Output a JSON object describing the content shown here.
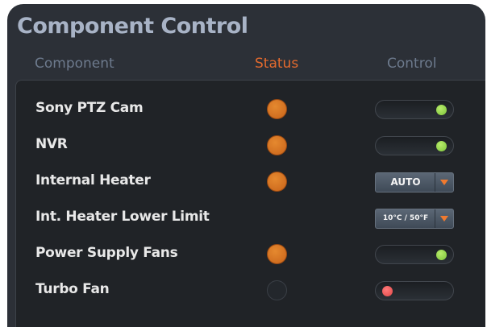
{
  "title": "Component Control",
  "headers": {
    "component": "Component",
    "status": "Status",
    "control": "Control"
  },
  "rows": [
    {
      "label": "Sony PTZ Cam",
      "status": "on",
      "control": {
        "type": "toggle",
        "state": "on"
      }
    },
    {
      "label": "NVR",
      "status": "on",
      "control": {
        "type": "toggle",
        "state": "on"
      }
    },
    {
      "label": "Internal Heater",
      "status": "on",
      "control": {
        "type": "select",
        "value": "AUTO"
      }
    },
    {
      "label": "Int. Heater Lower Limit",
      "status": "none",
      "control": {
        "type": "select",
        "value": "10°C / 50°F"
      }
    },
    {
      "label": "Power Supply Fans",
      "status": "on",
      "control": {
        "type": "toggle",
        "state": "on"
      }
    },
    {
      "label": "Turbo Fan",
      "status": "off",
      "control": {
        "type": "toggle",
        "state": "off"
      }
    }
  ],
  "colors": {
    "status_on": "#d8731f",
    "toggle_on": "#8ed14a",
    "toggle_off": "#e95050",
    "dropdown_arrow": "#f07a2f",
    "accent_header": "#e46a2e"
  }
}
